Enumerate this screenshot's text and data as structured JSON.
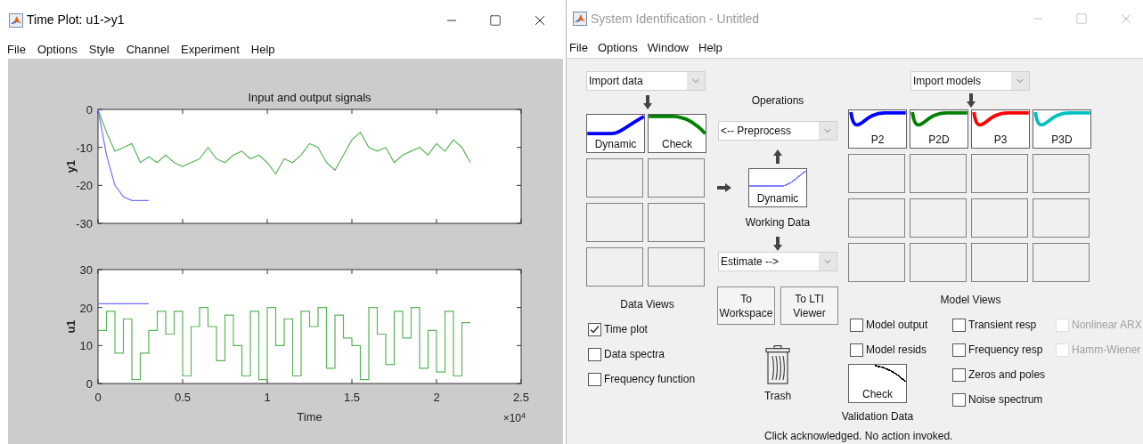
{
  "time_plot": {
    "title": "Time Plot: u1->y1",
    "active": true,
    "menu": [
      "File",
      "Options",
      "Style",
      "Channel",
      "Experiment",
      "Help"
    ],
    "charts": [
      {
        "chart_data": {
          "type": "line",
          "title": "Input and output signals",
          "ylabel": "y1",
          "xlim": [
            0,
            2.5
          ],
          "ylim": [
            -30,
            0
          ],
          "yticks": [
            -30,
            -20,
            -10,
            0
          ],
          "x": [
            0,
            0.05,
            0.1,
            0.15,
            0.2,
            0.25,
            0.3,
            0.35,
            0.4,
            0.45,
            0.5,
            0.55,
            0.6,
            0.65,
            0.7,
            0.75,
            0.8,
            0.85,
            0.9,
            0.95,
            1,
            1.05,
            1.1,
            1.15,
            1.2,
            1.25,
            1.3,
            1.35,
            1.4,
            1.45,
            1.5,
            1.55,
            1.6,
            1.65,
            1.7,
            1.75,
            1.8,
            1.85,
            1.9,
            1.95,
            2,
            2.05,
            2.1,
            2.15,
            2.2
          ],
          "series": [
            {
              "color": "#5ab55a",
              "values": [
                0,
                -6,
                -11,
                -10,
                -9,
                -14,
                -12.5,
                -14,
                -12,
                -14,
                -15,
                -14,
                -13,
                -10,
                -13,
                -14,
                -12,
                -11,
                -13,
                -12,
                -14,
                -17,
                -13,
                -14,
                -12,
                -9,
                -10,
                -14,
                -16,
                -12,
                -8,
                -6,
                -10,
                -11,
                -10,
                -14,
                -12,
                -11,
                -10,
                -12,
                -9,
                -11,
                -8,
                -10,
                -14
              ]
            },
            {
              "color": "#7070ff",
              "values": [
                0,
                -12,
                -20,
                -23,
                -24,
                -24,
                -24,
                null,
                null,
                null,
                null,
                null,
                null,
                null,
                null,
                null,
                null,
                null,
                null,
                null,
                null,
                null,
                null,
                null,
                null,
                null,
                null,
                null,
                null,
                null,
                null,
                null,
                null,
                null,
                null,
                null,
                null,
                null,
                null,
                null,
                null,
                null,
                null,
                null,
                null
              ]
            }
          ]
        }
      },
      {
        "chart_data": {
          "type": "line",
          "ylabel": "u1",
          "xlabel": "Time",
          "xlim": [
            0,
            2.5
          ],
          "ylim": [
            0,
            30
          ],
          "yticks": [
            0,
            10,
            20,
            30
          ],
          "xticks": [
            {
              "value": 0,
              "label": "0"
            },
            {
              "value": 0.5,
              "label": "0.5"
            },
            {
              "value": 1,
              "label": "1"
            },
            {
              "value": 1.5,
              "label": "1.5"
            },
            {
              "value": 2,
              "label": "2"
            },
            {
              "value": 2.5,
              "label": "2.5"
            }
          ],
          "x": [
            0,
            0.05,
            0.05,
            0.1,
            0.1,
            0.15,
            0.15,
            0.2,
            0.2,
            0.25,
            0.25,
            0.3,
            0.3,
            0.35,
            0.35,
            0.4,
            0.4,
            0.45,
            0.45,
            0.5,
            0.5,
            0.55,
            0.55,
            0.6,
            0.6,
            0.65,
            0.65,
            0.7,
            0.7,
            0.75,
            0.75,
            0.8,
            0.8,
            0.85,
            0.85,
            0.9,
            0.9,
            0.95,
            0.95,
            1,
            1,
            1.05,
            1.05,
            1.1,
            1.1,
            1.15,
            1.15,
            1.2,
            1.2,
            1.25,
            1.25,
            1.3,
            1.3,
            1.35,
            1.35,
            1.4,
            1.4,
            1.45,
            1.45,
            1.5,
            1.5,
            1.55,
            1.55,
            1.6,
            1.6,
            1.65,
            1.65,
            1.7,
            1.7,
            1.75,
            1.75,
            1.8,
            1.8,
            1.85,
            1.85,
            1.9,
            1.9,
            1.95,
            1.95,
            2,
            2,
            2.05,
            2.05,
            2.1,
            2.1,
            2.15,
            2.15,
            2.2
          ],
          "series": [
            {
              "color": "#5ab55a",
              "values": [
                14,
                14,
                19,
                19,
                8,
                8,
                17,
                17,
                1,
                1,
                8,
                8,
                14,
                14,
                19,
                19,
                13,
                13,
                19,
                19,
                2,
                2,
                15,
                15,
                20,
                20,
                15,
                15,
                6,
                6,
                18,
                18,
                10,
                10,
                2,
                2,
                19,
                19,
                1,
                1,
                20,
                20,
                10,
                10,
                17,
                17,
                2,
                2,
                19,
                19,
                15,
                15,
                20,
                20,
                4,
                4,
                18,
                18,
                12,
                12,
                10,
                10,
                1,
                1,
                20,
                20,
                13,
                13,
                5,
                5,
                19,
                19,
                12,
                12,
                20,
                20,
                4,
                4,
                14,
                14,
                3,
                3,
                19,
                19,
                2,
                2,
                16,
                16
              ]
            },
            {
              "color": "#7070ff",
              "values": [
                21,
                21,
                21,
                21,
                21,
                21,
                21,
                21,
                21,
                21,
                21,
                21,
                null,
                null,
                null,
                null,
                null,
                null,
                null,
                null,
                null,
                null,
                null,
                null,
                null,
                null,
                null,
                null,
                null,
                null,
                null,
                null,
                null,
                null,
                null,
                null,
                null,
                null,
                null,
                null,
                null,
                null,
                null,
                null,
                null,
                null,
                null,
                null,
                null,
                null,
                null,
                null,
                null,
                null,
                null,
                null,
                null,
                null,
                null,
                null,
                null,
                null,
                null,
                null,
                null,
                null,
                null,
                null,
                null,
                null,
                null,
                null,
                null,
                null,
                null,
                null,
                null,
                null,
                null,
                null,
                null,
                null,
                null,
                null,
                null,
                null,
                null,
                null
              ]
            }
          ]
        },
        "x_exponent": "×10$^{4}$"
      }
    ]
  },
  "system_identification": {
    "title": "System Identification - Untitled",
    "active": false,
    "menu": [
      "File",
      "Options",
      "Window",
      "Help"
    ],
    "import_data": "Import data",
    "import_models": "Import models",
    "operations": "Operations",
    "preprocess": "<-- Preprocess",
    "data_boards": [
      {
        "kind": "rise",
        "label": "Dynamic",
        "color": "#0000ff"
      },
      {
        "kind": "fall",
        "label": "Check",
        "color": "#008000"
      },
      {
        "kind": "empty"
      },
      {
        "kind": "empty"
      },
      {
        "kind": "empty"
      },
      {
        "kind": "empty"
      },
      {
        "kind": "empty"
      },
      {
        "kind": "empty"
      }
    ],
    "working_data": {
      "kind": "rise",
      "label": "Dynamic",
      "color": "#8080ff",
      "caption": "Working Data"
    },
    "estimate": "Estimate -->",
    "buttons": [
      "To Workspace",
      "To LTI Viewer"
    ],
    "data_views": {
      "title": "Data Views",
      "options": [
        {
          "label": "Time plot",
          "checked": true
        },
        {
          "label": "Data spectra",
          "checked": false
        },
        {
          "label": "Frequency function",
          "checked": false
        }
      ]
    },
    "trash": "Trash",
    "validation": {
      "kind": "fall",
      "label": "Check",
      "color": "#000000",
      "caption": "Validation Data"
    },
    "model_boards": [
      {
        "kind": "dip",
        "label": "P2",
        "color": "#0000ff"
      },
      {
        "kind": "dip",
        "label": "P2D",
        "color": "#008000"
      },
      {
        "kind": "dip",
        "label": "P3",
        "color": "#ff0000"
      },
      {
        "kind": "dip",
        "label": "P3D",
        "color": "#00c0c0"
      },
      {
        "kind": "empty"
      },
      {
        "kind": "empty"
      },
      {
        "kind": "empty"
      },
      {
        "kind": "empty"
      },
      {
        "kind": "empty"
      },
      {
        "kind": "empty"
      },
      {
        "kind": "empty"
      },
      {
        "kind": "empty"
      },
      {
        "kind": "empty"
      },
      {
        "kind": "empty"
      },
      {
        "kind": "empty"
      },
      {
        "kind": "empty"
      }
    ],
    "model_views": {
      "title": "Model Views",
      "columns": [
        [
          {
            "label": "Model output",
            "checked": false,
            "disabled": false
          },
          {
            "label": "Model resids",
            "checked": false,
            "disabled": false
          }
        ],
        [
          {
            "label": "Transient resp",
            "checked": false,
            "disabled": false
          },
          {
            "label": "Frequency resp",
            "checked": false,
            "disabled": false
          },
          {
            "label": "Zeros and poles",
            "checked": false,
            "disabled": false
          },
          {
            "label": "Noise spectrum",
            "checked": false,
            "disabled": false
          }
        ],
        [
          {
            "label": "Nonlinear ARX",
            "checked": false,
            "disabled": true
          },
          {
            "label": "Hamm-Wiener",
            "checked": false,
            "disabled": true
          }
        ]
      ]
    },
    "status": "Click acknowledged. No action invoked."
  }
}
